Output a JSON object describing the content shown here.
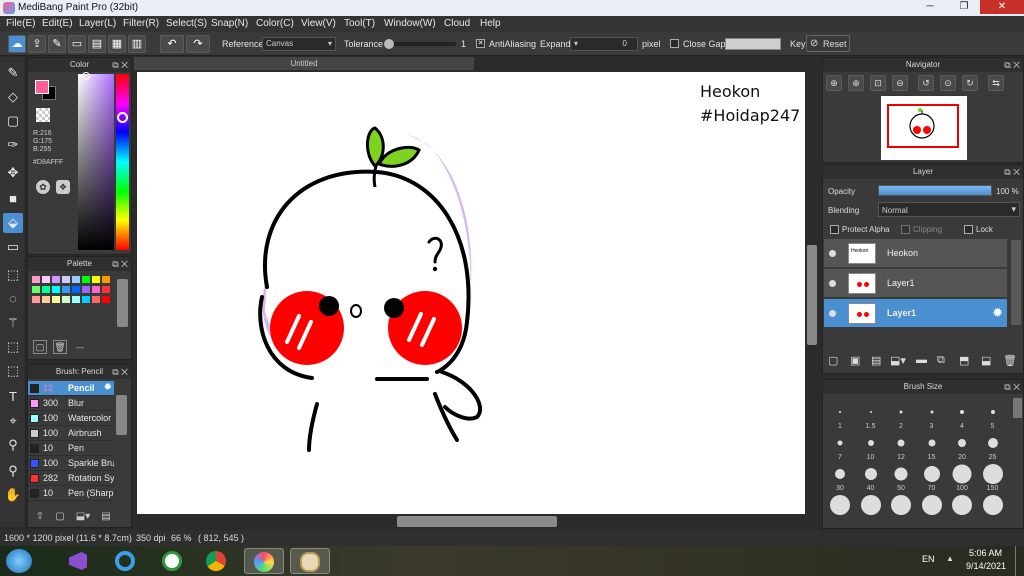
{
  "window": {
    "title": "MediBang Paint Pro (32bit)"
  },
  "menu": [
    "File(E)",
    "Edit(E)",
    "Layer(L)",
    "Filter(R)",
    "Select(S)",
    "Snap(N)",
    "Color(C)",
    "View(V)",
    "Tool(T)",
    "Window(W)",
    "Cloud",
    "Help"
  ],
  "toolbar": {
    "reference_label": "Reference",
    "reference_value": "Canvas",
    "tolerance_label": "Tolerance",
    "tolerance_value": "1",
    "antialiasing_label": "AntiAliasing",
    "expand_label": "Expand",
    "expand_value": "0",
    "expand_unit": "pixel",
    "close_gaps_label": "Close Gaps",
    "key_label": "Key",
    "reset_label": "Reset"
  },
  "color_panel": {
    "title": "Color",
    "r": "R:216",
    "g": "G:175",
    "b": "B:255",
    "hex": "#D8AFFF",
    "fg": "#ff5c9a",
    "bg": "#000000"
  },
  "palette_panel": {
    "title": "Palette",
    "more": "---",
    "colors": [
      "#ff99cc",
      "#ffccff",
      "#cc99ff",
      "#ccccff",
      "#99ccff",
      "#00ff00",
      "#ffff00",
      "#ff9900",
      "#66ff66",
      "#00ff99",
      "#00ffff",
      "#3399ff",
      "#0066ff",
      "#9966ff",
      "#ff66cc",
      "#ff3333",
      "#ff9999",
      "#ffcc99",
      "#ffff99",
      "#ccffcc",
      "#99ffff",
      "#00ccff",
      "#ff6666",
      "#ff0000"
    ]
  },
  "brush_panel": {
    "title": "Brush: Pencil",
    "items": [
      {
        "size": "12",
        "name": "Pencil",
        "color": "#222222"
      },
      {
        "size": "300",
        "name": "Blur",
        "color": "#ff99ff"
      },
      {
        "size": "100",
        "name": "Watercolor",
        "color": "#99ffff"
      },
      {
        "size": "100",
        "name": "Airbrush",
        "color": "#cccccc"
      },
      {
        "size": "10",
        "name": "Pen",
        "color": "#222222"
      },
      {
        "size": "100",
        "name": "Sparkle Brush",
        "color": "#3355ff"
      },
      {
        "size": "282",
        "name": "Rotation Symmetry",
        "color": "#ff3333"
      },
      {
        "size": "10",
        "name": "Pen (Sharp)",
        "color": "#222222"
      }
    ]
  },
  "document": {
    "tab_title": "Untitled"
  },
  "canvas_text": {
    "line1": "Heokon",
    "line2": "#Hoidap247"
  },
  "navigator": {
    "title": "Navigator"
  },
  "layer_panel": {
    "title": "Layer",
    "opacity_label": "Opacity",
    "opacity_value": "100 %",
    "opacity_fraction": 1.0,
    "blending_label": "Blending",
    "blending_value": "Normal",
    "protect_alpha": "Protect Alpha",
    "clipping": "Clipping",
    "lock": "Lock",
    "layers": [
      {
        "name": "Heokon"
      },
      {
        "name": "Layer1"
      },
      {
        "name": "Layer1"
      }
    ]
  },
  "brush_size_panel": {
    "title": "Brush Size",
    "sizes": [
      "1",
      "1.5",
      "2",
      "3",
      "4",
      "5",
      "7",
      "10",
      "12",
      "15",
      "20",
      "25",
      "30",
      "40",
      "50",
      "70",
      "100",
      "150",
      "",
      "",
      "",
      "",
      "",
      ""
    ]
  },
  "status": {
    "dimensions": "1600 * 1200 pixel",
    "physical": "(11.6 * 8.7cm)",
    "dpi": "350 dpi",
    "zoom": "66 %",
    "cursor": "( 812, 545 )"
  },
  "taskbar": {
    "lang": "EN",
    "time": "5:06 AM",
    "date": "9/14/2021"
  }
}
